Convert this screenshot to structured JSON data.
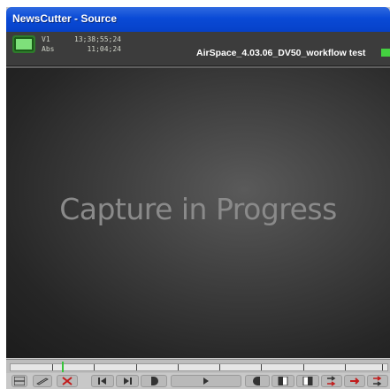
{
  "window": {
    "title": "NewsCutter - Source"
  },
  "info": {
    "track_label": "V1",
    "track_timecode": "13;38;55;24",
    "abs_label": "Abs",
    "abs_timecode": "11;04;24",
    "clip_name": "AirSpace_4.03.06_DV50_workflow test"
  },
  "viewer": {
    "message": "Capture in Progress"
  },
  "colors": {
    "titlebar": "#0a4ad6",
    "record_led": "#7ee07a",
    "playhead": "#37c43a"
  },
  "controls": {
    "icons": [
      "menu-icon",
      "pen-icon",
      "mark-clip-icon",
      "step-back-icon",
      "step-forward-icon",
      "mark-out-icon",
      "play-icon",
      "mark-in-icon",
      "splice-icon",
      "overwrite-icon",
      "lift-icon",
      "extract-icon",
      "insert-icon"
    ]
  }
}
